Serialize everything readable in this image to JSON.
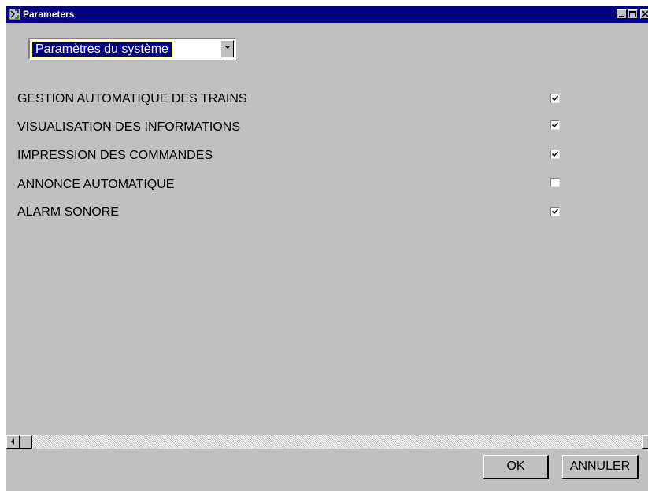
{
  "window": {
    "title": "Parameters",
    "title_icon": "app-icon",
    "controls": [
      "minimize-icon",
      "maximize-icon",
      "close-icon"
    ]
  },
  "category_select": {
    "value": "Paramètres du système",
    "dropdown_icon": "chevron-down-icon"
  },
  "parameters": [
    {
      "label": "GESTION AUTOMATIQUE DES TRAINS",
      "checked": true
    },
    {
      "label": "VISUALISATION DES INFORMATIONS",
      "checked": true
    },
    {
      "label": "IMPRESSION DES COMMANDES",
      "checked": true
    },
    {
      "label": "ANNONCE AUTOMATIQUE",
      "checked": false
    },
    {
      "label": "ALARM SONORE",
      "checked": true
    }
  ],
  "scrollbar": {
    "icons": [
      "scroll-left-icon",
      "scroll-right-icon"
    ]
  },
  "buttons": {
    "ok": "OK",
    "cancel": "ANNULER"
  },
  "colors": {
    "titlebar": "#000080",
    "face": "#c0c0c0",
    "selection": "#000080"
  }
}
